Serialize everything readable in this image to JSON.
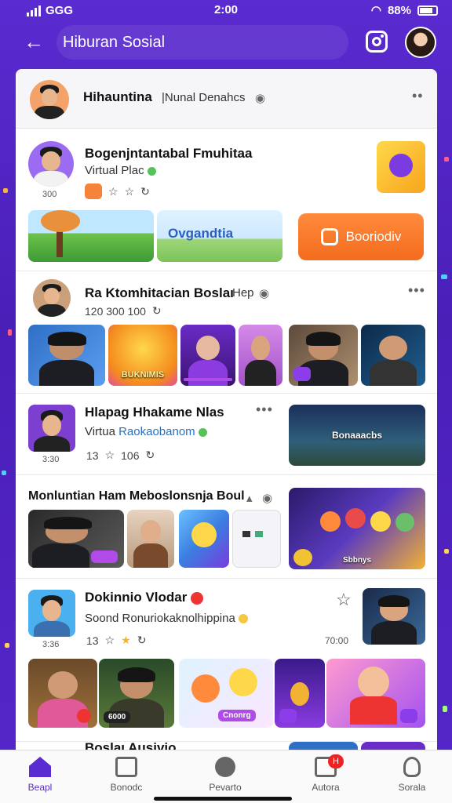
{
  "status": {
    "carrier": "GGG",
    "time": "2:00",
    "battery": "88%"
  },
  "appbar": {
    "title": "Hiburan Sosial"
  },
  "header": {
    "title": "Hihauntina",
    "subtitle": "|Nunal Denahcs"
  },
  "post1": {
    "title": "Bogenjntantabal Fmuhitaa",
    "subtitle": "Virtual Plac",
    "count": "300",
    "thumb_label": "Ovgandtia",
    "cta_label": "Booriodiv"
  },
  "post2": {
    "title": "Ra Ktomhitacian Boslaı",
    "tag": "Hep",
    "meta": "120 300  100",
    "thumbs": [
      "",
      "BUKNIMIS",
      "",
      "",
      "",
      ""
    ]
  },
  "post3": {
    "title": "Hlapag Hhakame Nlas",
    "subtitle_prefix": "Virtua",
    "subtitle_highlight": "Raokaobanom",
    "count": "13",
    "count2": "106",
    "avatar_count": "3:30",
    "thumb_label": "Bonaaacbs"
  },
  "post4": {
    "title": "Monluntian Ham Meboslonsnja Boul",
    "pill_label": "",
    "banner_label": "Sbbnys"
  },
  "post5": {
    "title": "Dokinnio Vlodar",
    "subtitle": "Soond Ronuriokaknolhippina",
    "count": "13",
    "avatar_count": "3:36",
    "time_label": "70:00",
    "thumb_labels": [
      "6000",
      "",
      "Cnonrg",
      ""
    ]
  },
  "post6": {
    "title": "Boslaı Ausivio"
  },
  "nav": {
    "items": [
      {
        "label": "Beapl"
      },
      {
        "label": "Bonodc"
      },
      {
        "label": "Pevarto"
      },
      {
        "label": "Autora"
      },
      {
        "label": "Sorala"
      }
    ],
    "badge": "H"
  },
  "colors": {
    "brand": "#5a2bd0",
    "accent": "#f46c1e"
  }
}
